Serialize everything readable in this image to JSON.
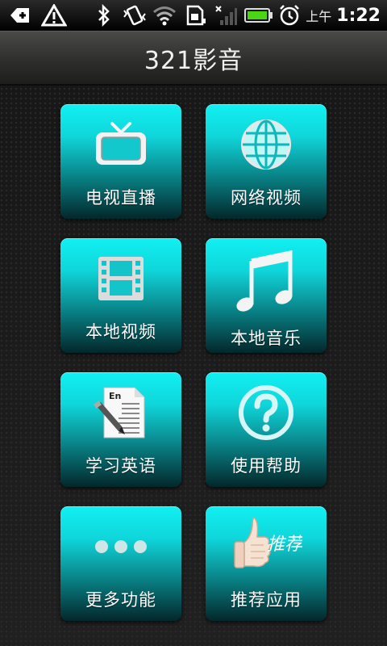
{
  "status_bar": {
    "ampm": "上午",
    "time": "1:22",
    "icons": [
      "usb-debug-icon",
      "warning-icon",
      "bluetooth-icon",
      "vibrate-icon",
      "wifi-icon",
      "sim-icon",
      "signal-icon",
      "battery-icon",
      "alarm-icon"
    ]
  },
  "header": {
    "title": "321影音"
  },
  "menu": {
    "items": [
      {
        "label": "电视直播",
        "icon": "tv-icon"
      },
      {
        "label": "网络视频",
        "icon": "globe-icon"
      },
      {
        "label": "本地视频",
        "icon": "film-icon"
      },
      {
        "label": "本地音乐",
        "icon": "music-note-icon"
      },
      {
        "label": "学习英语",
        "icon": "english-dictionary-icon"
      },
      {
        "label": "使用帮助",
        "icon": "help-question-icon"
      },
      {
        "label": "更多功能",
        "icon": "more-dots-icon"
      },
      {
        "label": "推荐应用",
        "icon": "thumbs-up-icon",
        "badge_text": "推荐"
      }
    ]
  },
  "colors": {
    "tile_top": "#12f0f2",
    "tile_bottom": "#03272a",
    "title_text": "#f2f2f2"
  }
}
